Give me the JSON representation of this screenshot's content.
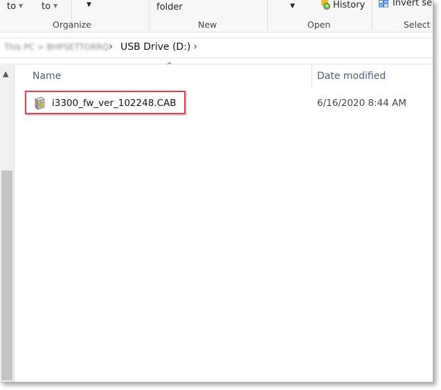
{
  "ribbon": {
    "fragments": {
      "to_1": "to",
      "to_2": "to",
      "folder": "folder",
      "history": "History",
      "invert": "Invert sele"
    },
    "groups": {
      "organize": "Organize",
      "new": "New",
      "open": "Open",
      "select": "Select"
    }
  },
  "address_bar": {
    "blurred_segment": "This PC > BHPSETTORRQ",
    "current_location": "USB Drive (D:)"
  },
  "file_list": {
    "columns": {
      "name": "Name",
      "date_modified": "Date modified"
    },
    "items": [
      {
        "name": "i3300_fw_ver_102248.CAB",
        "date_modified": "6/16/2020 8:44 AM",
        "icon": "cab-archive-icon"
      }
    ]
  },
  "colors": {
    "highlight_border": "#e2414b",
    "header_text": "#4c607a"
  }
}
